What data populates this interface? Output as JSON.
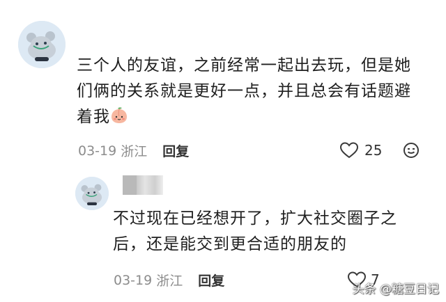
{
  "main_comment": {
    "text_lines": [
      "三个人的友谊，之前经常一起出去玩，但是她",
      "们俩的关系就是更好一点，并且总会有话题避",
      "着我"
    ],
    "emoji": "peach-face-emoji",
    "date": "03-19",
    "location": "浙江",
    "reply_label": "回复",
    "like_count": "25"
  },
  "reply_comment": {
    "text_lines": [
      "不过现在已经想开了，扩大社交圈子之",
      "后，还是能交到更合适的朋友的"
    ],
    "date": "03-19",
    "location": "浙江",
    "reply_label": "回复",
    "like_count": "7"
  },
  "watermark": "头条 @糖豆日记"
}
